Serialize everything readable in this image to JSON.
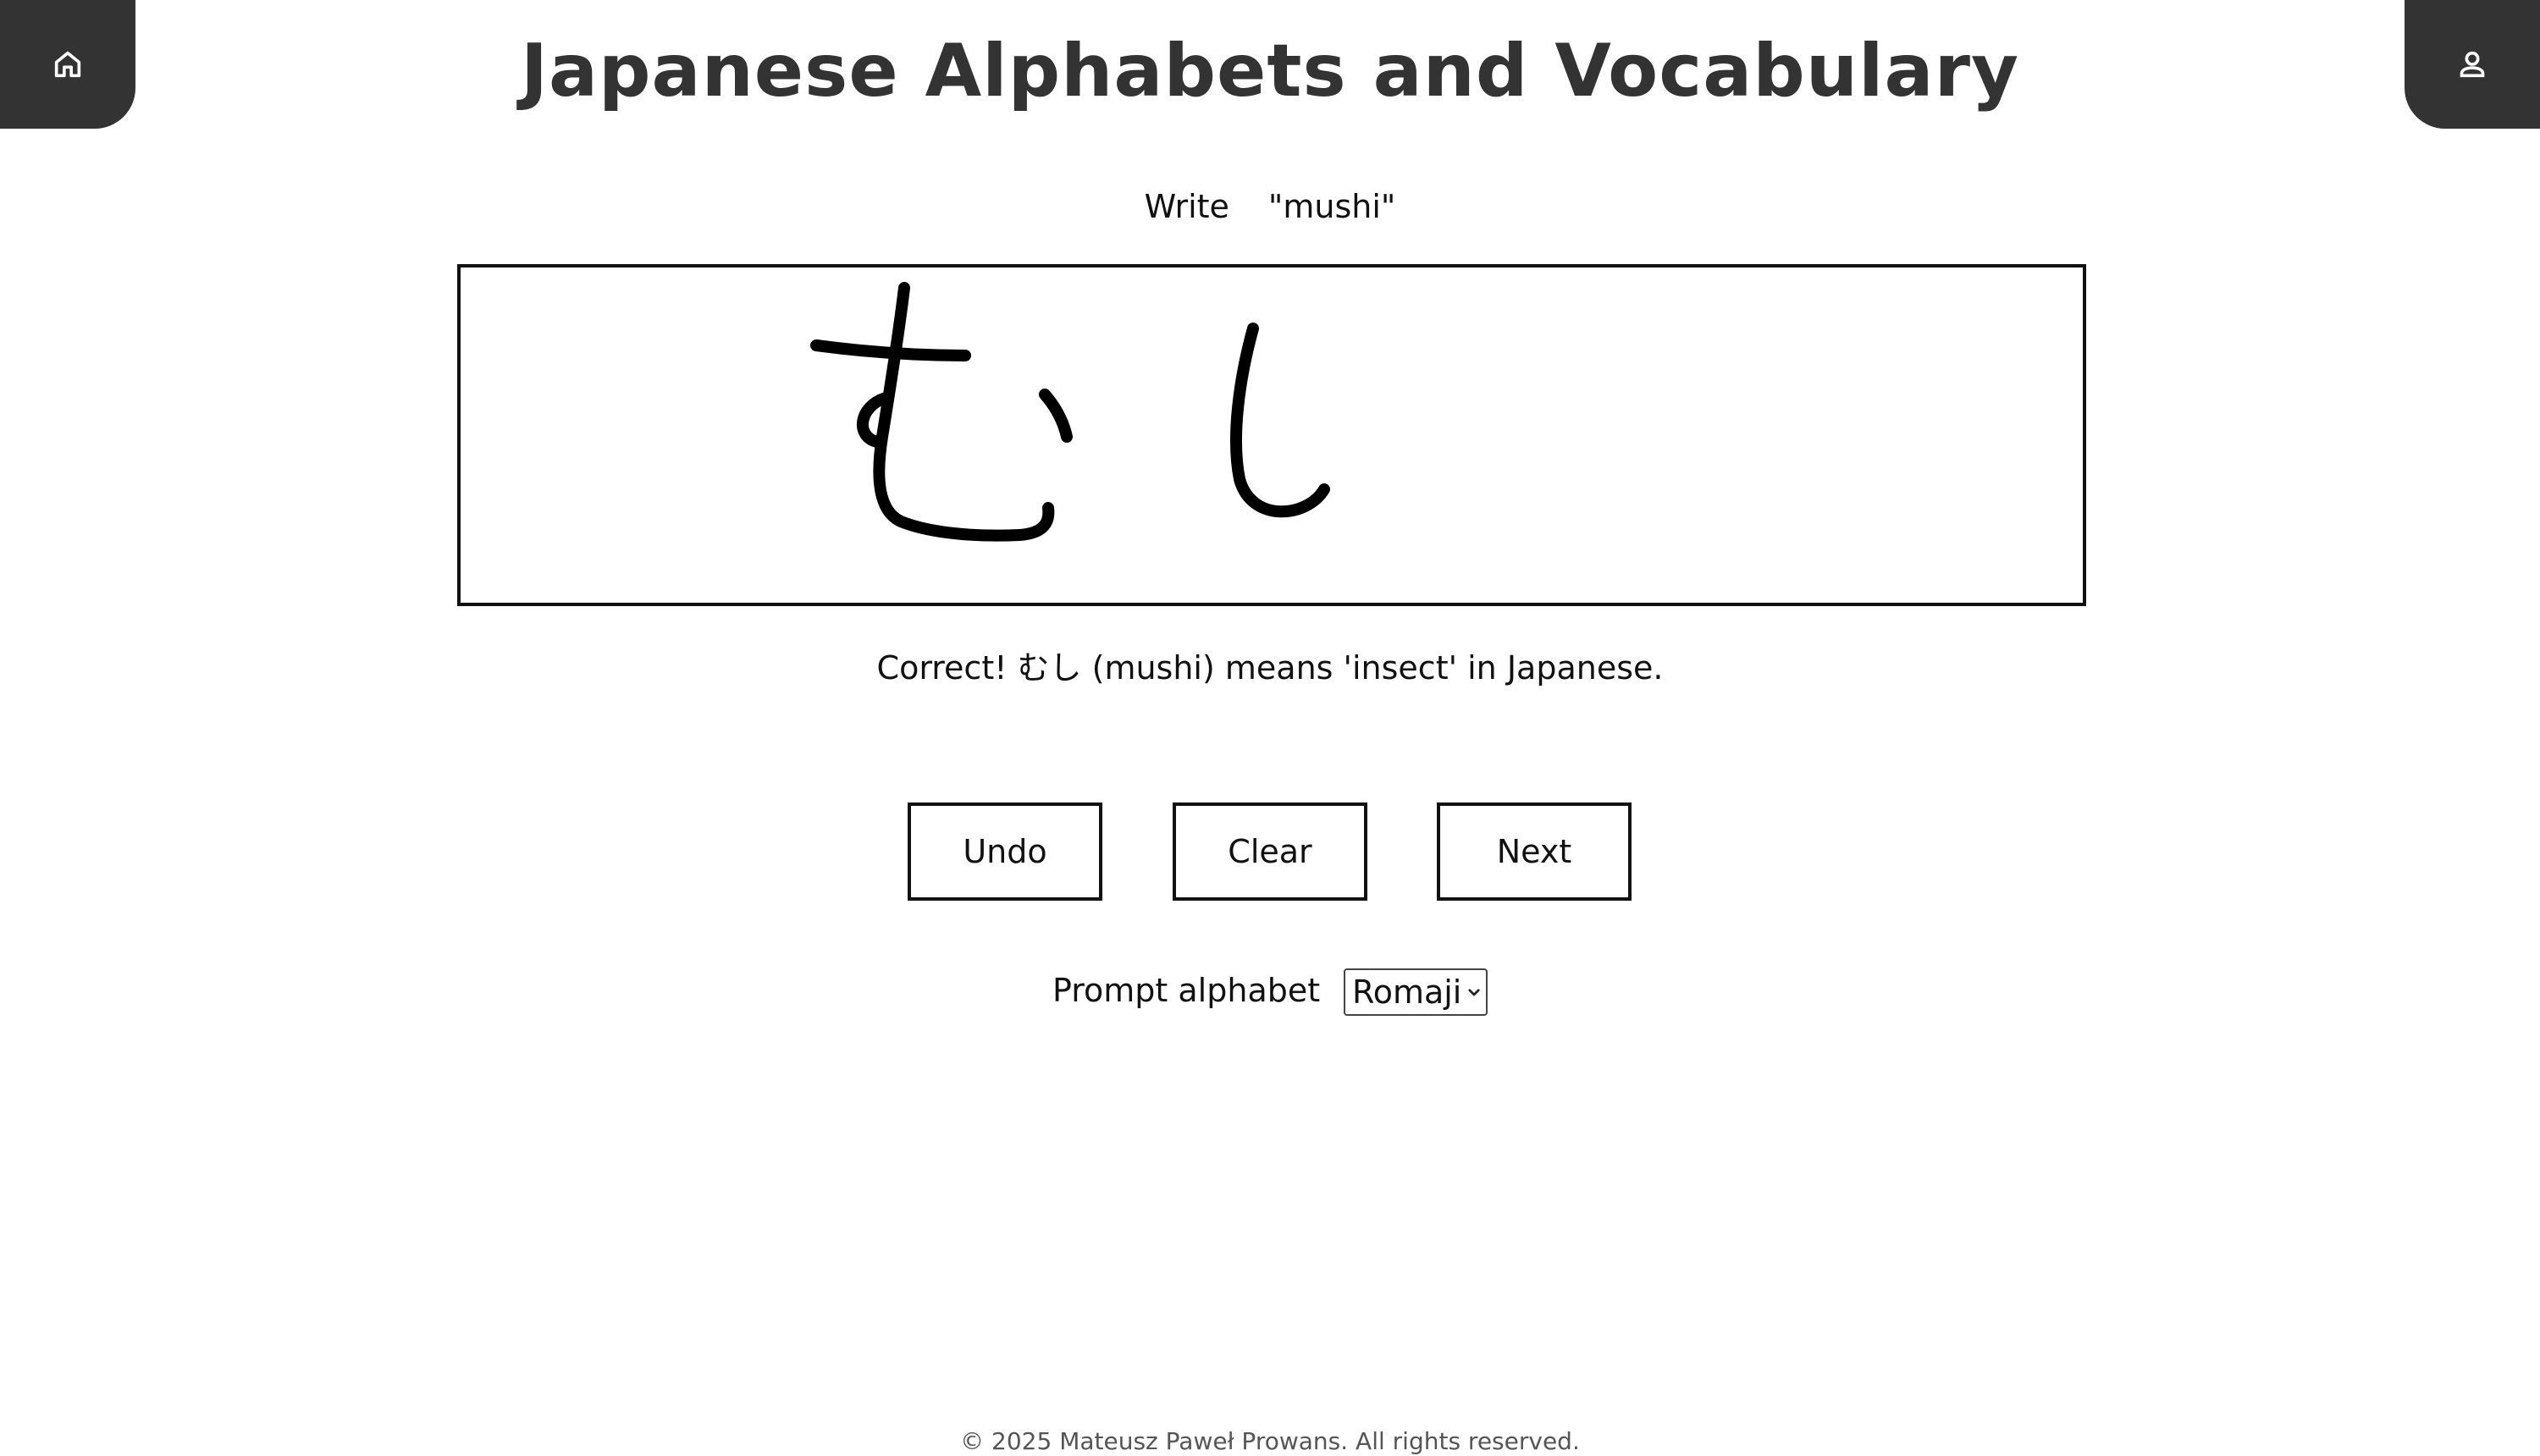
{
  "header": {
    "title": "Japanese Alphabets and Vocabulary",
    "home_icon": "home-icon",
    "profile_icon": "user-icon",
    "corner_color": "#333333"
  },
  "prompt": {
    "label": "Write",
    "word": "\"mushi\""
  },
  "drawing_area": {
    "drawn_kana": "むし"
  },
  "feedback": {
    "text": "Correct! むし (mushi) means 'insect' in Japanese."
  },
  "controls": {
    "undo_label": "Undo",
    "clear_label": "Clear",
    "next_label": "Next"
  },
  "prompt_alphabet": {
    "label": "Prompt alphabet",
    "selected": "Romaji"
  },
  "footer": {
    "copyright": "© 2025 Mateusz Paweł Prowans. All rights reserved."
  }
}
